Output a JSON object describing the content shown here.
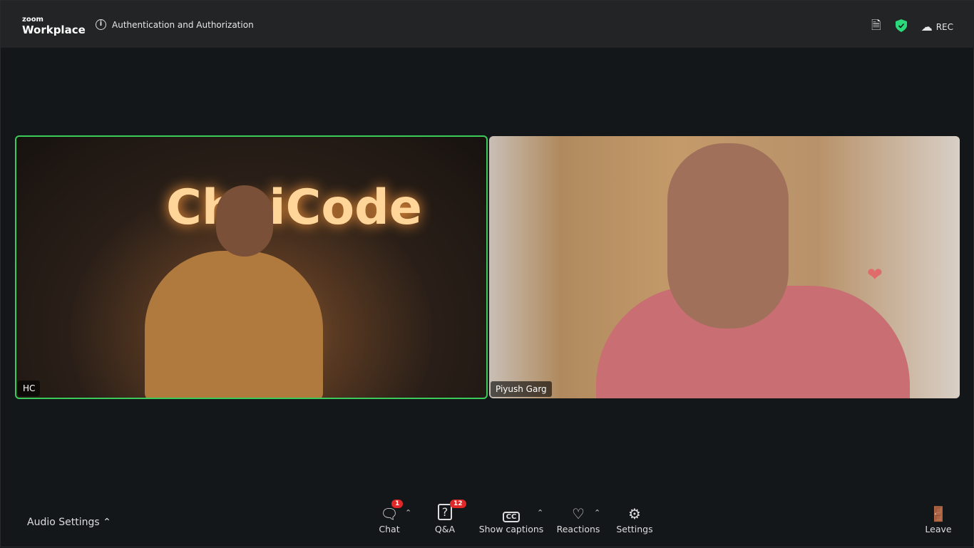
{
  "header": {
    "brand_small": "zoom",
    "brand": "Workplace",
    "meeting_title": "Authentication and Authorization",
    "rec_label": "REC",
    "colors": {
      "shield": "#2bd97c"
    }
  },
  "tiles": [
    {
      "name": "HC",
      "sign": "ChaiCode"
    },
    {
      "name": "Piyush Garg"
    }
  ],
  "toolbar": {
    "audio_settings": "Audio Settings",
    "chat": "Chat",
    "chat_badge": "1",
    "qa": "Q&A",
    "qa_badge": "12",
    "captions": "Show captions",
    "captions_icon": "CC",
    "reactions": "Reactions",
    "settings": "Settings",
    "leave": "Leave"
  }
}
